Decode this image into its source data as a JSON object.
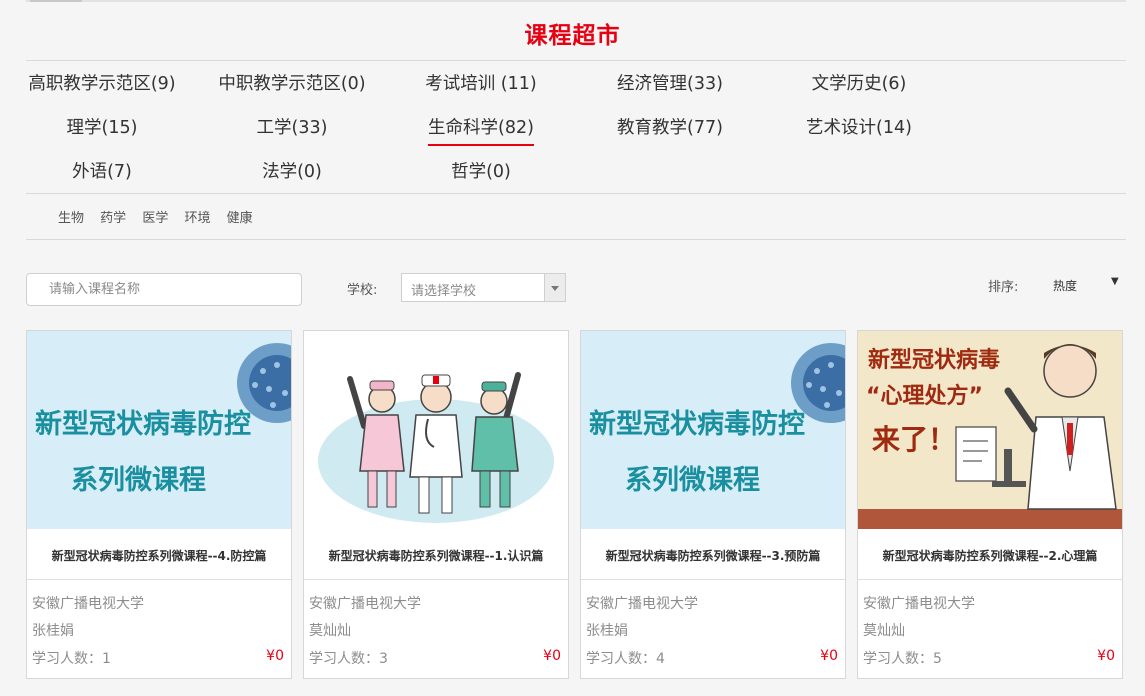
{
  "page_title": "课程超市",
  "categories": [
    {
      "label": "高职教学示范区(9)"
    },
    {
      "label": "中职教学示范区(0)"
    },
    {
      "label": "考试培训 (11)"
    },
    {
      "label": "经济管理(33)"
    },
    {
      "label": "文学历史(6)"
    },
    {
      "label": "理学(15)"
    },
    {
      "label": "工学(33)"
    },
    {
      "label": "生命科学(82)",
      "active": true
    },
    {
      "label": "教育教学(77)"
    },
    {
      "label": "艺术设计(14)"
    },
    {
      "label": "外语(7)"
    },
    {
      "label": "法学(0)"
    },
    {
      "label": "哲学(0)"
    }
  ],
  "subcategories": [
    "生物",
    "药学",
    "医学",
    "环境",
    "健康"
  ],
  "filters": {
    "search_placeholder": "请输入课程名称",
    "school_label": "学校:",
    "school_placeholder": "请选择学校",
    "sort_label": "排序:",
    "sort_value": "热度",
    "sort_arrow": "▼"
  },
  "courses": [
    {
      "banner_lines": [
        "新型冠状病毒防控",
        "系列微课程"
      ],
      "title": "新型冠状病毒防控系列微课程--4.防控篇",
      "school": "安徽广播电视大学",
      "teacher": "张桂娟",
      "learners": "学习人数：1",
      "price": "¥0"
    },
    {
      "title": "新型冠状病毒防控系列微课程--1.认识篇",
      "school": "安徽广播电视大学",
      "teacher": "莫灿灿",
      "learners": "学习人数：3",
      "price": "¥0"
    },
    {
      "banner_lines": [
        "新型冠状病毒防控",
        "系列微课程"
      ],
      "title": "新型冠状病毒防控系列微课程--3.预防篇",
      "school": "安徽广播电视大学",
      "teacher": "张桂娟",
      "learners": "学习人数：4",
      "price": "¥0"
    },
    {
      "banner_lines": [
        "新型冠状病毒",
        "“心理处方”",
        "来了！"
      ],
      "title": "新型冠状病毒防控系列微课程--2.心理篇",
      "school": "安徽广播电视大学",
      "teacher": "莫灿灿",
      "learners": "学习人数：5",
      "price": "¥0"
    }
  ],
  "colors": {
    "accent": "#e60012",
    "banner_bg": "#d7eef8",
    "banner_text": "#1a8fa0",
    "psych_bg": "#f3e7c9",
    "psych_text": "#a02a10"
  }
}
